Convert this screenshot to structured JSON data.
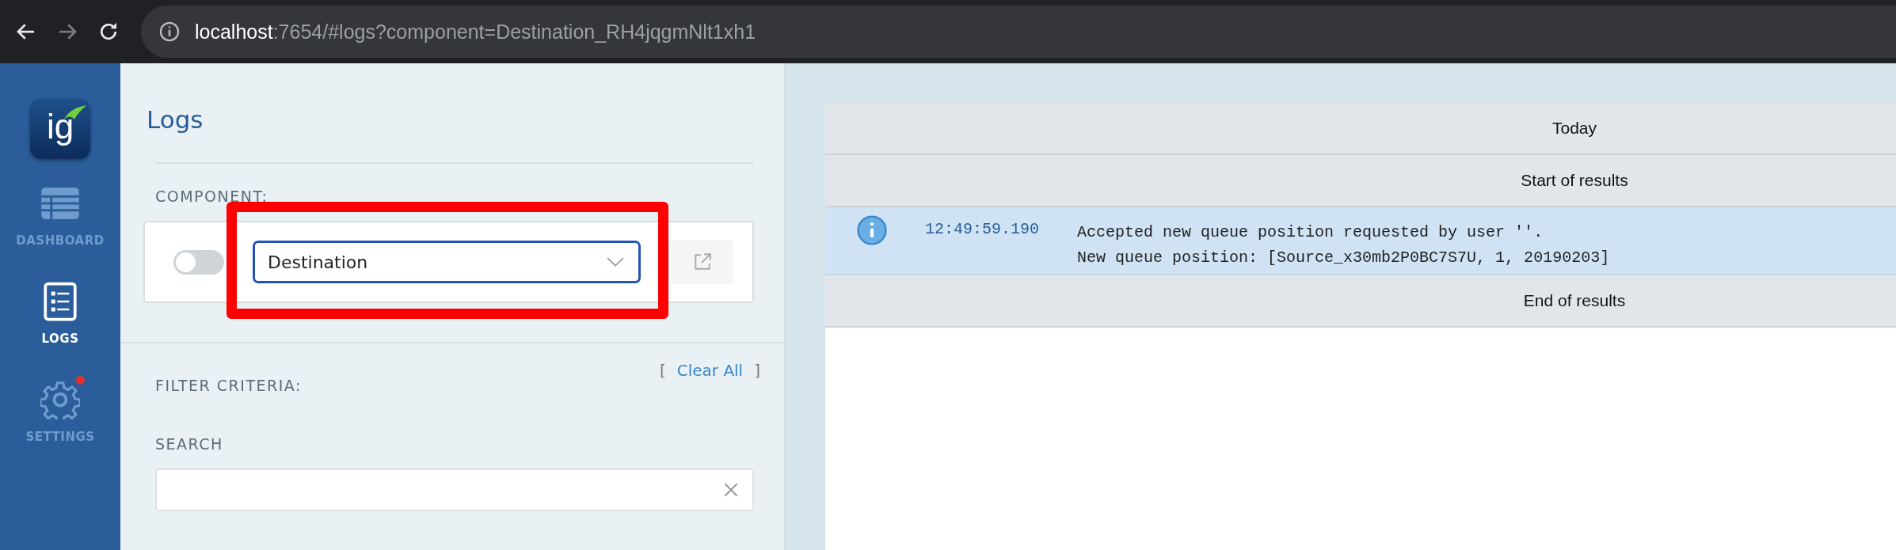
{
  "browser": {
    "url_host": "localhost",
    "url_rest": ":7654/#logs?component=Destination_RH4jqgmNlt1xh1",
    "forward_disabled": true
  },
  "sidebar": {
    "logo_text": "ig",
    "items": [
      {
        "kind": "dashboard",
        "label": "DASHBOARD",
        "selected": false,
        "alert": false
      },
      {
        "kind": "logs",
        "label": "LOGS",
        "selected": true,
        "alert": false
      },
      {
        "kind": "settings",
        "label": "SETTINGS",
        "selected": false,
        "alert": true
      }
    ]
  },
  "panel": {
    "title": "Logs",
    "component_label": "COMPONENT:",
    "toggle": {
      "on": false
    },
    "component_select": {
      "value": "Destination"
    },
    "highlighted": true,
    "filter_label": "FILTER CRITERIA:",
    "clear_all": "Clear All",
    "clear_all_open": "[",
    "clear_all_close": "]",
    "search_label": "SEARCH"
  },
  "log": {
    "rows": [
      {
        "kind": "header",
        "text": "Today"
      },
      {
        "kind": "header",
        "text": "Start of results"
      },
      {
        "kind": "info",
        "time": "12:49:59.190",
        "lines": [
          "Accepted new queue position requested by user ''.",
          "New queue position: [Source_x30mb2P0BC7S7U, 1, 20190203]"
        ]
      },
      {
        "kind": "header",
        "text": "End of results"
      }
    ]
  }
}
